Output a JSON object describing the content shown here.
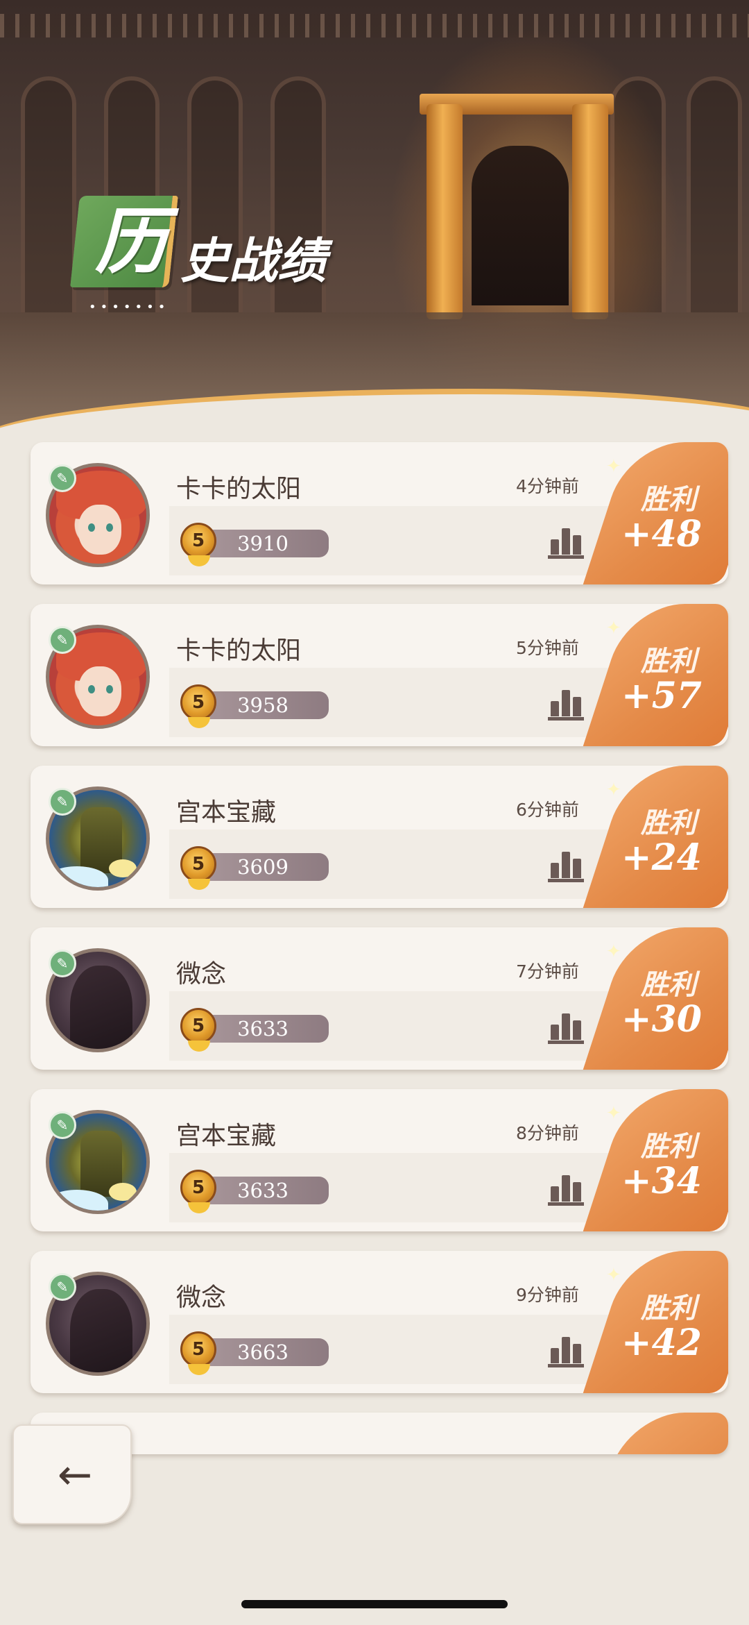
{
  "header": {
    "title_first_char": "历",
    "title_rest": "史战绩",
    "dots": "•••••••"
  },
  "records": [
    {
      "name": "卡卡的太阳",
      "time": "4分钟前",
      "score": "3910",
      "rank": "5",
      "result": "胜利",
      "delta": "+48",
      "avatar": "red-hair-character"
    },
    {
      "name": "卡卡的太阳",
      "time": "5分钟前",
      "score": "3958",
      "rank": "5",
      "result": "胜利",
      "delta": "+57",
      "avatar": "red-hair-character"
    },
    {
      "name": "宫本宝藏",
      "time": "6分钟前",
      "score": "3609",
      "rank": "5",
      "result": "胜利",
      "delta": "+24",
      "avatar": "tree-spirit-character"
    },
    {
      "name": "微念",
      "time": "7分钟前",
      "score": "3633",
      "rank": "5",
      "result": "胜利",
      "delta": "+30",
      "avatar": "hooded-character"
    },
    {
      "name": "宫本宝藏",
      "time": "8分钟前",
      "score": "3633",
      "rank": "5",
      "result": "胜利",
      "delta": "+34",
      "avatar": "tree-spirit-character"
    },
    {
      "name": "微念",
      "time": "9分钟前",
      "score": "3663",
      "rank": "5",
      "result": "胜利",
      "delta": "+42",
      "avatar": "hooded-character"
    }
  ],
  "icons": {
    "back": "back-arrow-icon",
    "stats": "bar-chart-icon",
    "rank": "rank-medal-icon",
    "edit": "edit-pencil-icon"
  },
  "colors": {
    "win": "#e48a48",
    "card": "#f8f4ef",
    "text": "#4a3b35",
    "score_pill": "#9c8a8f"
  }
}
